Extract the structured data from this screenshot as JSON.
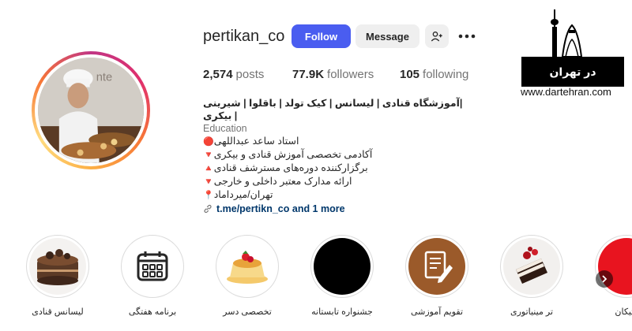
{
  "profile": {
    "username": "pertikan_co",
    "follow_label": "Follow",
    "message_label": "Message",
    "avatar_text": "nte"
  },
  "stats": {
    "posts_count": "2,574",
    "posts_label": "posts",
    "followers_count": "77.9K",
    "followers_label": "followers",
    "following_count": "105",
    "following_label": "following"
  },
  "bio": {
    "name": "|آموزشگاه قنادی | لیسانس | کیک تولد | باقلوا | شیرینی | بیکری",
    "category": "Education",
    "lines": [
      {
        "mark": "🔴",
        "text": "استاد ساعد عبداللهی"
      },
      {
        "mark": "🔻",
        "text": "آکادمی تخصصی آموزش قنادی و بیکری"
      },
      {
        "mark": "🔺",
        "text": "برگزارکننده دوره‌های مسترشف قنادی"
      },
      {
        "mark": "🔻",
        "text": "ارائه مدارک معتبر داخلی و خارجی"
      },
      {
        "mark": "📍",
        "text": "تهران/میرداماد"
      }
    ],
    "link": "t.me/pertikn_co and 1 more"
  },
  "logo": {
    "band_text": "در تهران",
    "url": "www.dartehran.com"
  },
  "highlights": [
    {
      "label": "لیسانس قنادی",
      "icon": "chocolate-cake"
    },
    {
      "label": "برنامه هفتگی",
      "icon": "calendar-icon"
    },
    {
      "label": "تخصصی دسر",
      "icon": "dessert"
    },
    {
      "label": "جشنواره تابستانه",
      "icon": "black-circle"
    },
    {
      "label": "تقویم آموزشی",
      "icon": "document-pen-icon"
    },
    {
      "label": "تر مینیاتوری",
      "icon": "mini-cake"
    },
    {
      "label": "رتیکان",
      "icon": "red-circle"
    }
  ],
  "colors": {
    "follow_blue": "#4a5df0",
    "secondary_button": "#efefef",
    "link_blue": "#00376b",
    "muted_text": "#737373"
  }
}
